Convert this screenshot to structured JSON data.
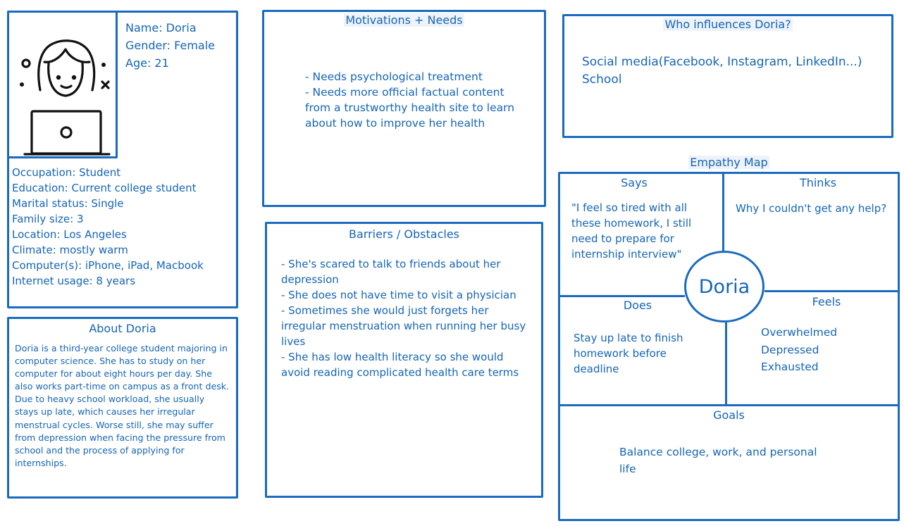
{
  "profile": {
    "name": "Name: Doria",
    "gender": "Gender: Female",
    "age": "Age: 21",
    "details": [
      "Occupation: Student",
      "Education: Current college student",
      "Marital status: Single",
      "Family size: 3",
      "Location: Los Angeles",
      "Climate: mostly warm",
      "Computer(s): iPhone, iPad, Macbook",
      "Internet usage: 8 years"
    ]
  },
  "about": {
    "title": "About Doria",
    "lines": [
      "Doria is a third-year college student majoring in",
      "computer science. She has to study on her",
      "computer for about eight hours per day. She",
      "also works part-time on campus as a front desk.",
      "Due to heavy school workload, she usually",
      "stays up late, which causes her irregular",
      "menstrual cycles. Worse still, she may suffer",
      "from depression when facing the pressure from",
      "school and the process of applying for",
      "internships."
    ]
  },
  "motivations": {
    "title": "Motivations + Needs",
    "lines": [
      "-  Needs psychological treatment",
      "- Needs more official factual content",
      "from a trustworthy health site to learn",
      "about how to improve her health"
    ]
  },
  "barriers": {
    "title": "Barriers / Obstacles",
    "lines": [
      "- She's scared to talk to friends about her",
      "depression",
      "- She does not have time to visit a physician",
      "- Sometimes she would just forgets her",
      "irregular menstruation when running her busy",
      "lives",
      "- She has low health literacy so she would",
      "avoid reading complicated health care terms"
    ]
  },
  "influences": {
    "title": "Who influences Doria?",
    "lines": [
      "Social media(Facebook, Instagram, LinkedIn...)",
      "School"
    ]
  },
  "empathy": {
    "title": "Empathy Map",
    "center": "Doria",
    "says": {
      "label": "Says",
      "lines": [
        "\"I feel so tired with all",
        "these homework, I still",
        "need to prepare for",
        "internship interview\""
      ]
    },
    "thinks": {
      "label": "Thinks",
      "lines": [
        "Why I couldn't get any help?"
      ]
    },
    "does": {
      "label": "Does",
      "lines": [
        "Stay up late to finish",
        "homework before",
        "deadline"
      ]
    },
    "feels": {
      "label": "Feels",
      "lines": [
        "Overwhelmed",
        "Depressed",
        "Exhausted"
      ]
    },
    "goals": {
      "label": "Goals",
      "lines": [
        "Balance college, work, and personal",
        "life"
      ]
    }
  },
  "colors": {
    "accent": "#1a6bbf",
    "text": "#1565b7"
  }
}
